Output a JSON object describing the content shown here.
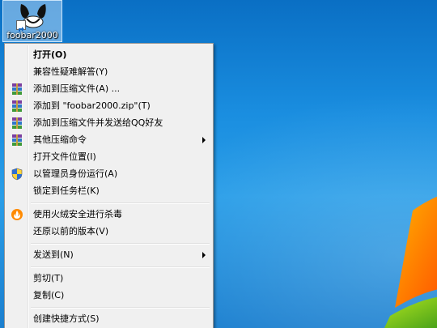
{
  "desktop": {
    "icon_label": "foobar2000"
  },
  "menu": {
    "items": [
      {
        "label": "打开(O)",
        "icon": "none"
      },
      {
        "label": "兼容性疑难解答(Y)",
        "icon": "none"
      },
      {
        "label": "添加到压缩文件(A) ...",
        "icon": "winrar-icon"
      },
      {
        "label": "添加到 \"foobar2000.zip\"(T)",
        "icon": "winrar-icon"
      },
      {
        "label": "添加到压缩文件并发送给QQ好友",
        "icon": "winrar-icon"
      },
      {
        "label": "其他压缩命令",
        "icon": "winrar-icon",
        "submenu": true
      },
      {
        "label": "打开文件位置(I)",
        "icon": "none"
      },
      {
        "label": "以管理员身份运行(A)",
        "icon": "uac-shield-icon"
      },
      {
        "label": "锁定到任务栏(K)",
        "icon": "none"
      },
      {
        "label": "使用火绒安全进行杀毒",
        "icon": "huorong-icon"
      },
      {
        "label": "还原以前的版本(V)",
        "icon": "none"
      },
      {
        "label": "发送到(N)",
        "icon": "none",
        "submenu": true
      },
      {
        "label": "剪切(T)",
        "icon": "none"
      },
      {
        "label": "复制(C)",
        "icon": "none"
      },
      {
        "label": "创建快捷方式(S)",
        "icon": "none"
      }
    ]
  },
  "colors": {
    "menu_bg": "#f0f0f0",
    "desktop_blue": "#1a8ee0",
    "flag_orange": "#ff7a00"
  }
}
